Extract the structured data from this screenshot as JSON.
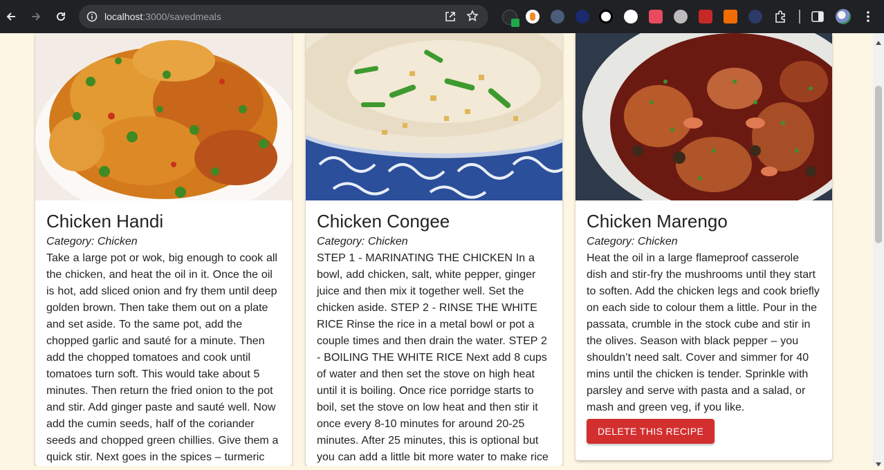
{
  "browser": {
    "url_host": "localhost",
    "url_path": ":3000/savedmeals"
  },
  "recipes": [
    {
      "title": "Chicken Handi",
      "category": "Category: Chicken",
      "instructions": "Take a large pot or wok, big enough to cook all the chicken, and heat the oil in it. Once the oil is hot, add sliced onion and fry them until deep golden brown. Then take them out on a plate and set aside. To the same pot, add the chopped garlic and sauté for a minute. Then add the chopped tomatoes and cook until tomatoes turn soft. This would take about 5 minutes. Then return the fried onion to the pot and stir. Add ginger paste and sauté well. Now add the cumin seeds, half of the coriander seeds and chopped green chillies. Give them a quick stir. Next goes in the spices – turmeric"
    },
    {
      "title": "Chicken Congee",
      "category": "Category: Chicken",
      "instructions": "STEP 1 - MARINATING THE CHICKEN In a bowl, add chicken, salt, white pepper, ginger juice and then mix it together well. Set the chicken aside. STEP 2 - RINSE THE WHITE RICE Rinse the rice in a metal bowl or pot a couple times and then drain the water. STEP 2 - BOILING THE WHITE RICE Next add 8 cups of water and then set the stove on high heat until it is boiling. Once rice porridge starts to boil, set the stove on low heat and then stir it once every 8-10 minutes for around 20-25 minutes. After 25 minutes, this is optional but you can add a little bit more water to make rice"
    },
    {
      "title": "Chicken Marengo",
      "category": "Category: Chicken",
      "instructions": "Heat the oil in a large flameproof casserole dish and stir-fry the mushrooms until they start to soften. Add the chicken legs and cook briefly on each side to colour them a little. Pour in the passata, crumble in the stock cube and stir in the olives. Season with black pepper – you shouldn’t need salt. Cover and simmer for 40 mins until the chicken is tender. Sprinkle with parsley and serve with pasta and a salad, or mash and green veg, if you like.",
      "delete_label": "DELETE THIS RECIPE"
    }
  ],
  "colors": {
    "page_bg": "#fdf6e3",
    "delete_button": "#d32f2f"
  }
}
